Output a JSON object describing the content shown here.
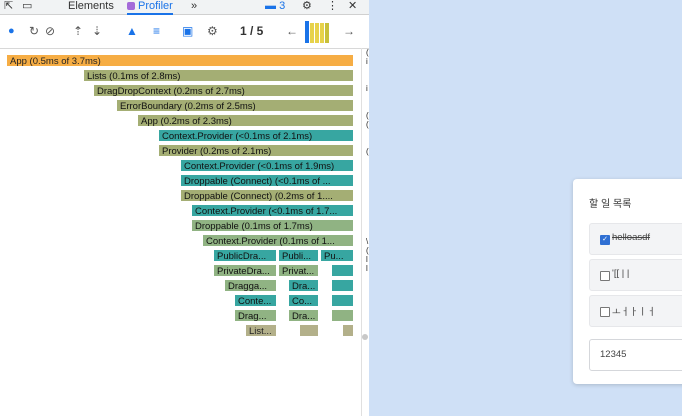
{
  "devtools": {
    "tabs": [
      "Elements",
      "Profiler"
    ],
    "active_tab": "Profiler",
    "more_tabs": "»",
    "messages_count": "3",
    "commit_counter": "1 / 5",
    "colors": {
      "active_tab": "#1a73e8",
      "record": "#1a73e8",
      "profiler_badge": "#a46ad9",
      "flame_icon": "#1a73e8"
    }
  },
  "flamegraph": {
    "bars": [
      {
        "label": "App (0.5ms of 3.7ms)"
      },
      {
        "label": "Lists (0.1ms of 2.8ms)"
      },
      {
        "label": "DragDropContext (0.2ms of 2.7ms)"
      },
      {
        "label": "ErrorBoundary (0.2ms of 2.5ms)"
      },
      {
        "label": "App (0.2ms of 2.3ms)"
      },
      {
        "label": "Context.Provider (<0.1ms of 2.1ms)"
      },
      {
        "label": "Provider (0.2ms of 2.1ms)"
      },
      {
        "label": "Context.Provider (<0.1ms of 1.9ms)"
      },
      {
        "label": "Droppable (Connect) (<0.1ms of ..."
      },
      {
        "label": "Droppable (Connect) (0.2ms of 1...."
      },
      {
        "label": "Context.Provider (<0.1ms of 1.7..."
      },
      {
        "label": "Droppable (0.1ms of 1.7ms)"
      },
      {
        "label": "Context.Provider (0.1ms of 1..."
      },
      {
        "label": "PublicDra..."
      },
      {
        "label": "Publi..."
      },
      {
        "label": "Pu..."
      },
      {
        "label": "PrivateDra..."
      },
      {
        "label": "Privat..."
      },
      {
        "label": "Dragga..."
      },
      {
        "label": "Dra..."
      },
      {
        "label": "Conte..."
      },
      {
        "label": "Co..."
      },
      {
        "label": "Drag..."
      },
      {
        "label": "Dra..."
      },
      {
        "label": "List..."
      }
    ]
  },
  "gutter_glyphs": [
    "(",
    "i",
    "",
    "",
    "i",
    "",
    "",
    "(",
    "(",
    "",
    "",
    "(",
    "",
    "",
    "",
    "",
    "",
    "",
    "",
    "",
    "",
    "\\",
    "(",
    "l",
    "l"
  ],
  "todo": {
    "title": "할 일 목록",
    "items": [
      {
        "label": "helloasdf",
        "done": true
      },
      {
        "label": "'[[ | |",
        "done": false
      },
      {
        "label": "ㅗㅓㅏㅣㅓ",
        "done": false
      }
    ],
    "input_value": "12345"
  }
}
